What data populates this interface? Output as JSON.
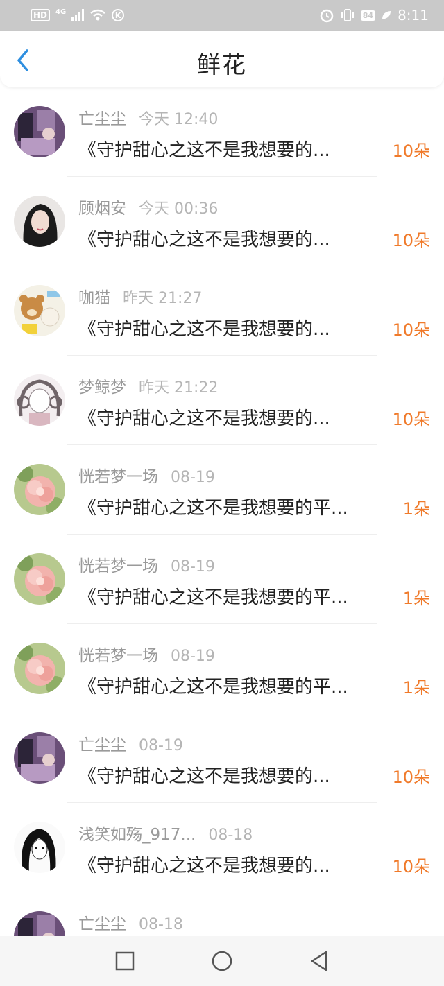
{
  "status_bar": {
    "hd": "HD",
    "network": "4G",
    "k_icon": "K",
    "battery": "84",
    "time": "8:11"
  },
  "header": {
    "title": "鲜花"
  },
  "list": [
    {
      "name": "亡尘尘",
      "time": "今天 12:40",
      "message": "《守护甜心之这不是我想要的...",
      "count": "10朵",
      "avatar_style": "purple-room"
    },
    {
      "name": "顾烟安",
      "time": "今天 00:36",
      "message": "《守护甜心之这不是我想要的...",
      "count": "10朵",
      "avatar_style": "girl-portrait"
    },
    {
      "name": "咖猫",
      "time": "昨天 21:27",
      "message": "《守护甜心之这不是我想要的...",
      "count": "10朵",
      "avatar_style": "cartoon-bears"
    },
    {
      "name": "梦鲸梦",
      "time": "昨天 21:22",
      "message": "《守护甜心之这不是我想要的...",
      "count": "10朵",
      "avatar_style": "sketch-girl"
    },
    {
      "name": "恍若梦一场",
      "time": "08-19",
      "message": "《守护甜心之这不是我想要的平...",
      "count": "1朵",
      "avatar_style": "pink-flower"
    },
    {
      "name": "恍若梦一场",
      "time": "08-19",
      "message": "《守护甜心之这不是我想要的平...",
      "count": "1朵",
      "avatar_style": "pink-flower"
    },
    {
      "name": "恍若梦一场",
      "time": "08-19",
      "message": "《守护甜心之这不是我想要的平...",
      "count": "1朵",
      "avatar_style": "pink-flower"
    },
    {
      "name": "亡尘尘",
      "time": "08-19",
      "message": "《守护甜心之这不是我想要的...",
      "count": "10朵",
      "avatar_style": "purple-room"
    },
    {
      "name": "浅笑如殇_917...",
      "time": "08-18",
      "message": "《守护甜心之这不是我想要的...",
      "count": "10朵",
      "avatar_style": "manga-girl"
    },
    {
      "name": "亡尘尘",
      "time": "08-18",
      "message": "",
      "count": "",
      "avatar_style": "purple-room"
    }
  ],
  "colors": {
    "accent_orange": "#f07a2a",
    "back_blue": "#2f8fe0",
    "status_bar_bg": "#c9c9c9"
  },
  "icons": {
    "back": "chevron-left-icon",
    "nav_recent": "square-icon",
    "nav_home": "circle-icon",
    "nav_back": "triangle-left-icon"
  }
}
